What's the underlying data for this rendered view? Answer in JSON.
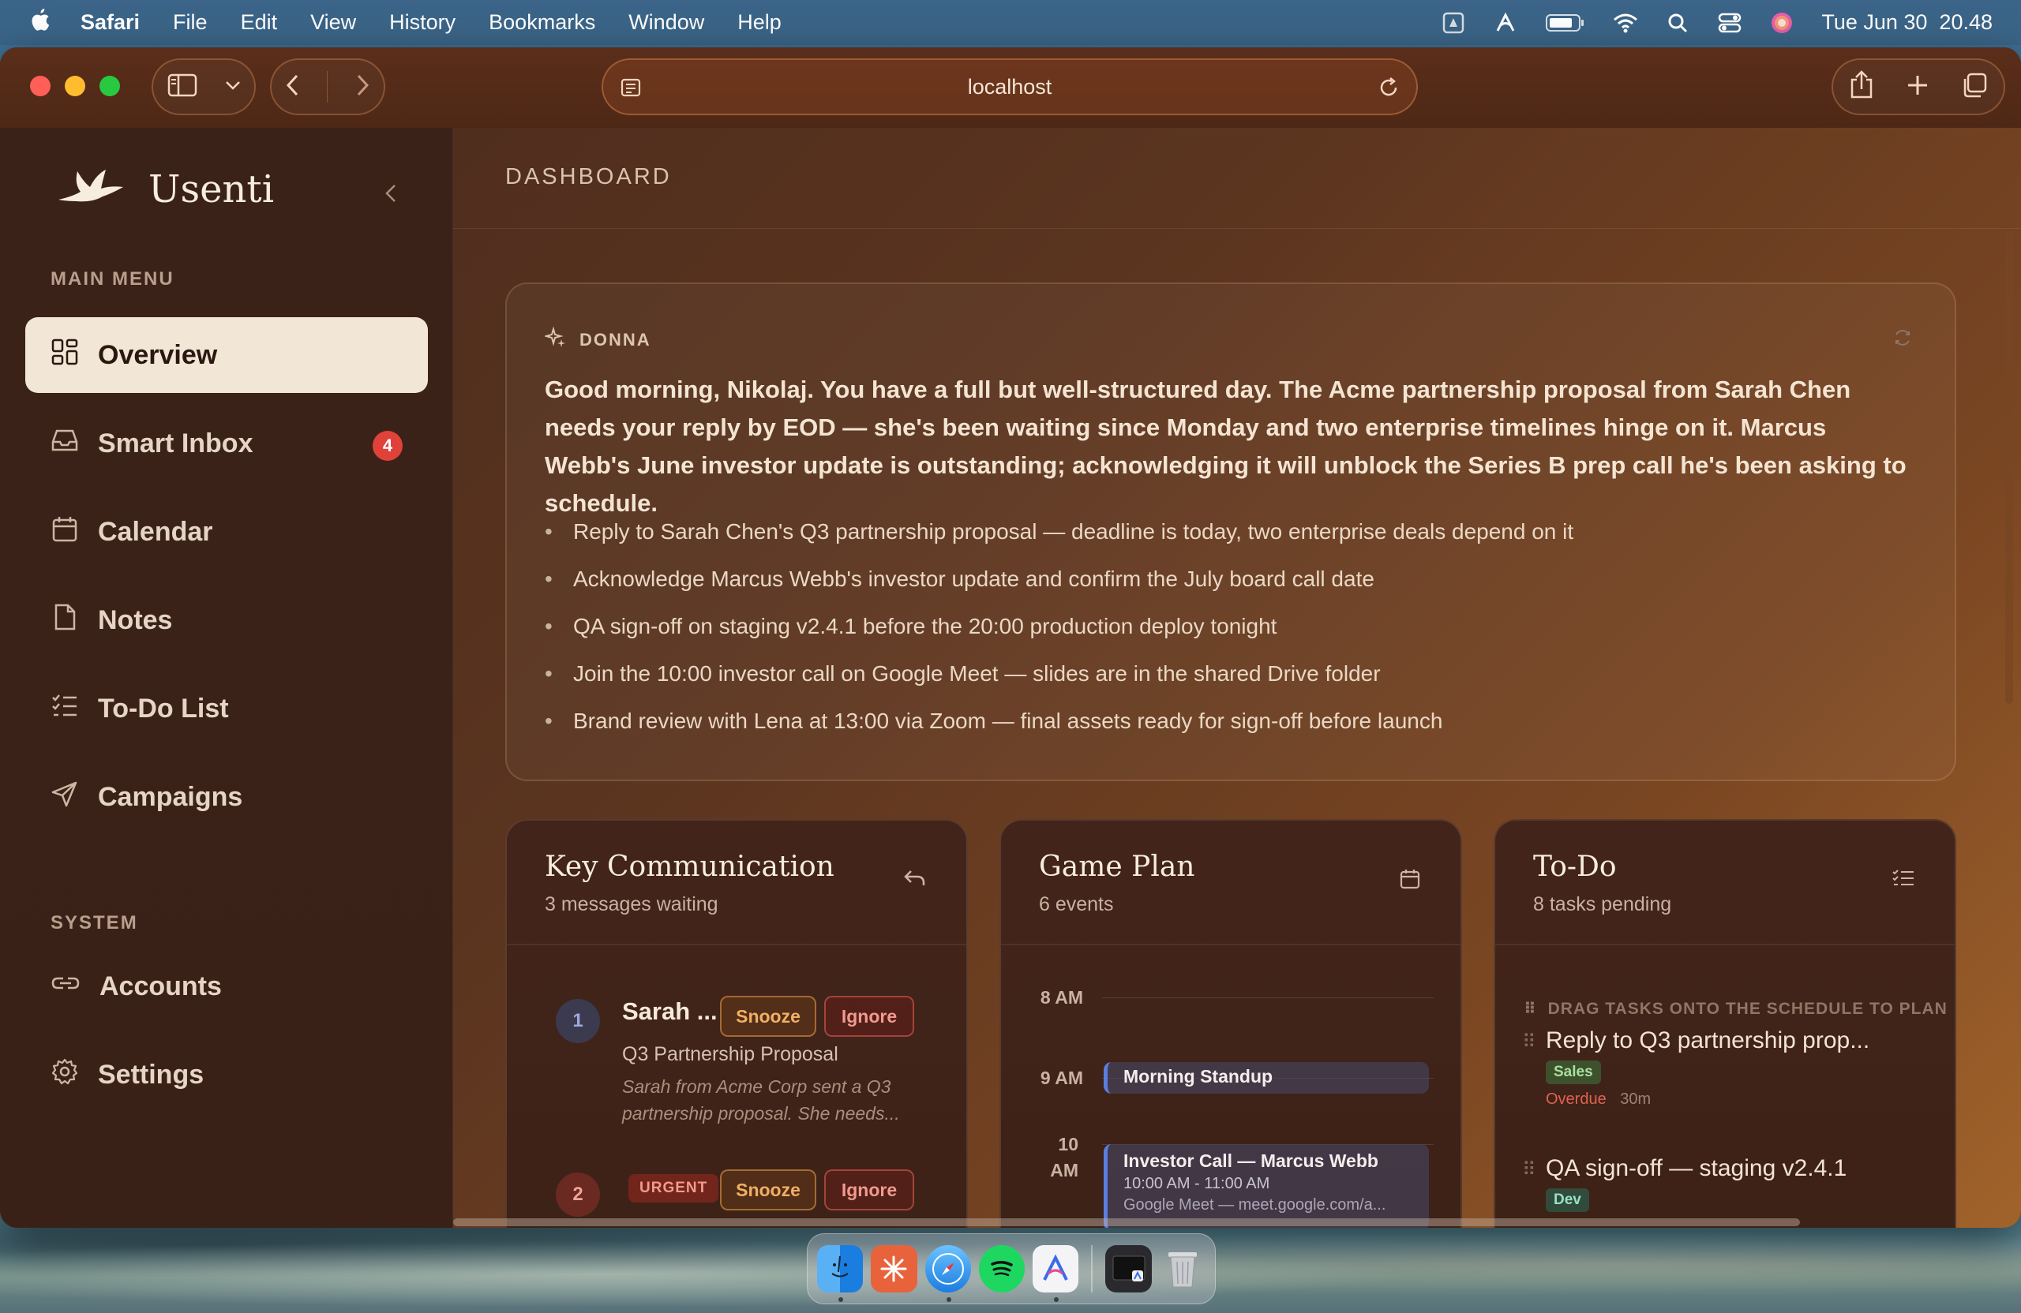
{
  "menubar": {
    "app_name": "Safari",
    "items": [
      "File",
      "Edit",
      "View",
      "History",
      "Bookmarks",
      "Window",
      "Help"
    ],
    "clock": "Tue Jun 30  20.48"
  },
  "browser": {
    "url": "localhost"
  },
  "sidebar": {
    "brand": "Usenti",
    "main_menu_label": "MAIN MENU",
    "system_label": "SYSTEM",
    "items": [
      {
        "label": "Overview",
        "icon": "grid-icon"
      },
      {
        "label": "Smart Inbox",
        "icon": "inbox-icon",
        "badge": "4"
      },
      {
        "label": "Calendar",
        "icon": "calendar-icon"
      },
      {
        "label": "Notes",
        "icon": "note-icon"
      },
      {
        "label": "To-Do List",
        "icon": "checklist-icon"
      },
      {
        "label": "Campaigns",
        "icon": "send-icon"
      }
    ],
    "system_items": [
      {
        "label": "Accounts",
        "icon": "link-icon"
      },
      {
        "label": "Settings",
        "icon": "gear-icon"
      }
    ]
  },
  "main": {
    "title": "DASHBOARD",
    "donna": {
      "label": "DONNA",
      "summary": "Good morning, Nikolaj. You have a full but well-structured day. The Acme partnership proposal from Sarah Chen needs your reply by EOD — she's been waiting since Monday and two enterprise timelines hinge on it. Marcus Webb's June investor update is outstanding; acknowledging it will unblock the Series B prep call he's been asking to schedule.",
      "bullets": [
        "Reply to Sarah Chen's Q3 partnership proposal — deadline is today, two enterprise deals depend on it",
        "Acknowledge Marcus Webb's investor update and confirm the July board call date",
        "QA sign-off on staging v2.4.1 before the 20:00 production deploy tonight",
        "Join the 10:00 investor call on Google Meet — slides are in the shared Drive folder",
        "Brand review with Lena at 13:00 via Zoom — final assets ready for sign-off before launch"
      ]
    },
    "key_comm": {
      "title": "Key Communication",
      "subtitle": "3 messages waiting",
      "snooze_label": "Snooze",
      "ignore_label": "Ignore",
      "urgent_label": "URGENT",
      "messages": [
        {
          "num": "1",
          "sender": "Sarah ...",
          "subject": "Q3 Partnership Proposal",
          "preview": "Sarah from Acme Corp sent a Q3 partnership proposal. She needs..."
        },
        {
          "num": "2"
        }
      ]
    },
    "game_plan": {
      "title": "Game Plan",
      "subtitle": "6 events",
      "hours": [
        "8 AM",
        "9 AM",
        "10 AM"
      ],
      "events": [
        {
          "title": "Morning Standup"
        },
        {
          "title": "Investor Call — Marcus Webb",
          "time": "10:00 AM - 11:00 AM",
          "location": "Google Meet — meet.google.com/a..."
        }
      ]
    },
    "todo": {
      "title": "To-Do",
      "subtitle": "8 tasks pending",
      "hint": "DRAG TASKS ONTO THE SCHEDULE TO PLAN",
      "tasks": [
        {
          "title": "Reply to Q3 partnership prop...",
          "tag": "Sales",
          "status": "Overdue",
          "duration": "30m"
        },
        {
          "title": "QA sign-off — staging v2.4.1",
          "tag": "Dev"
        }
      ]
    }
  },
  "colors": {
    "accent_badge": "#e0423a",
    "snooze": "#f0b065",
    "ignore": "#f19a8f",
    "event_bar": "#5a7fe0"
  }
}
